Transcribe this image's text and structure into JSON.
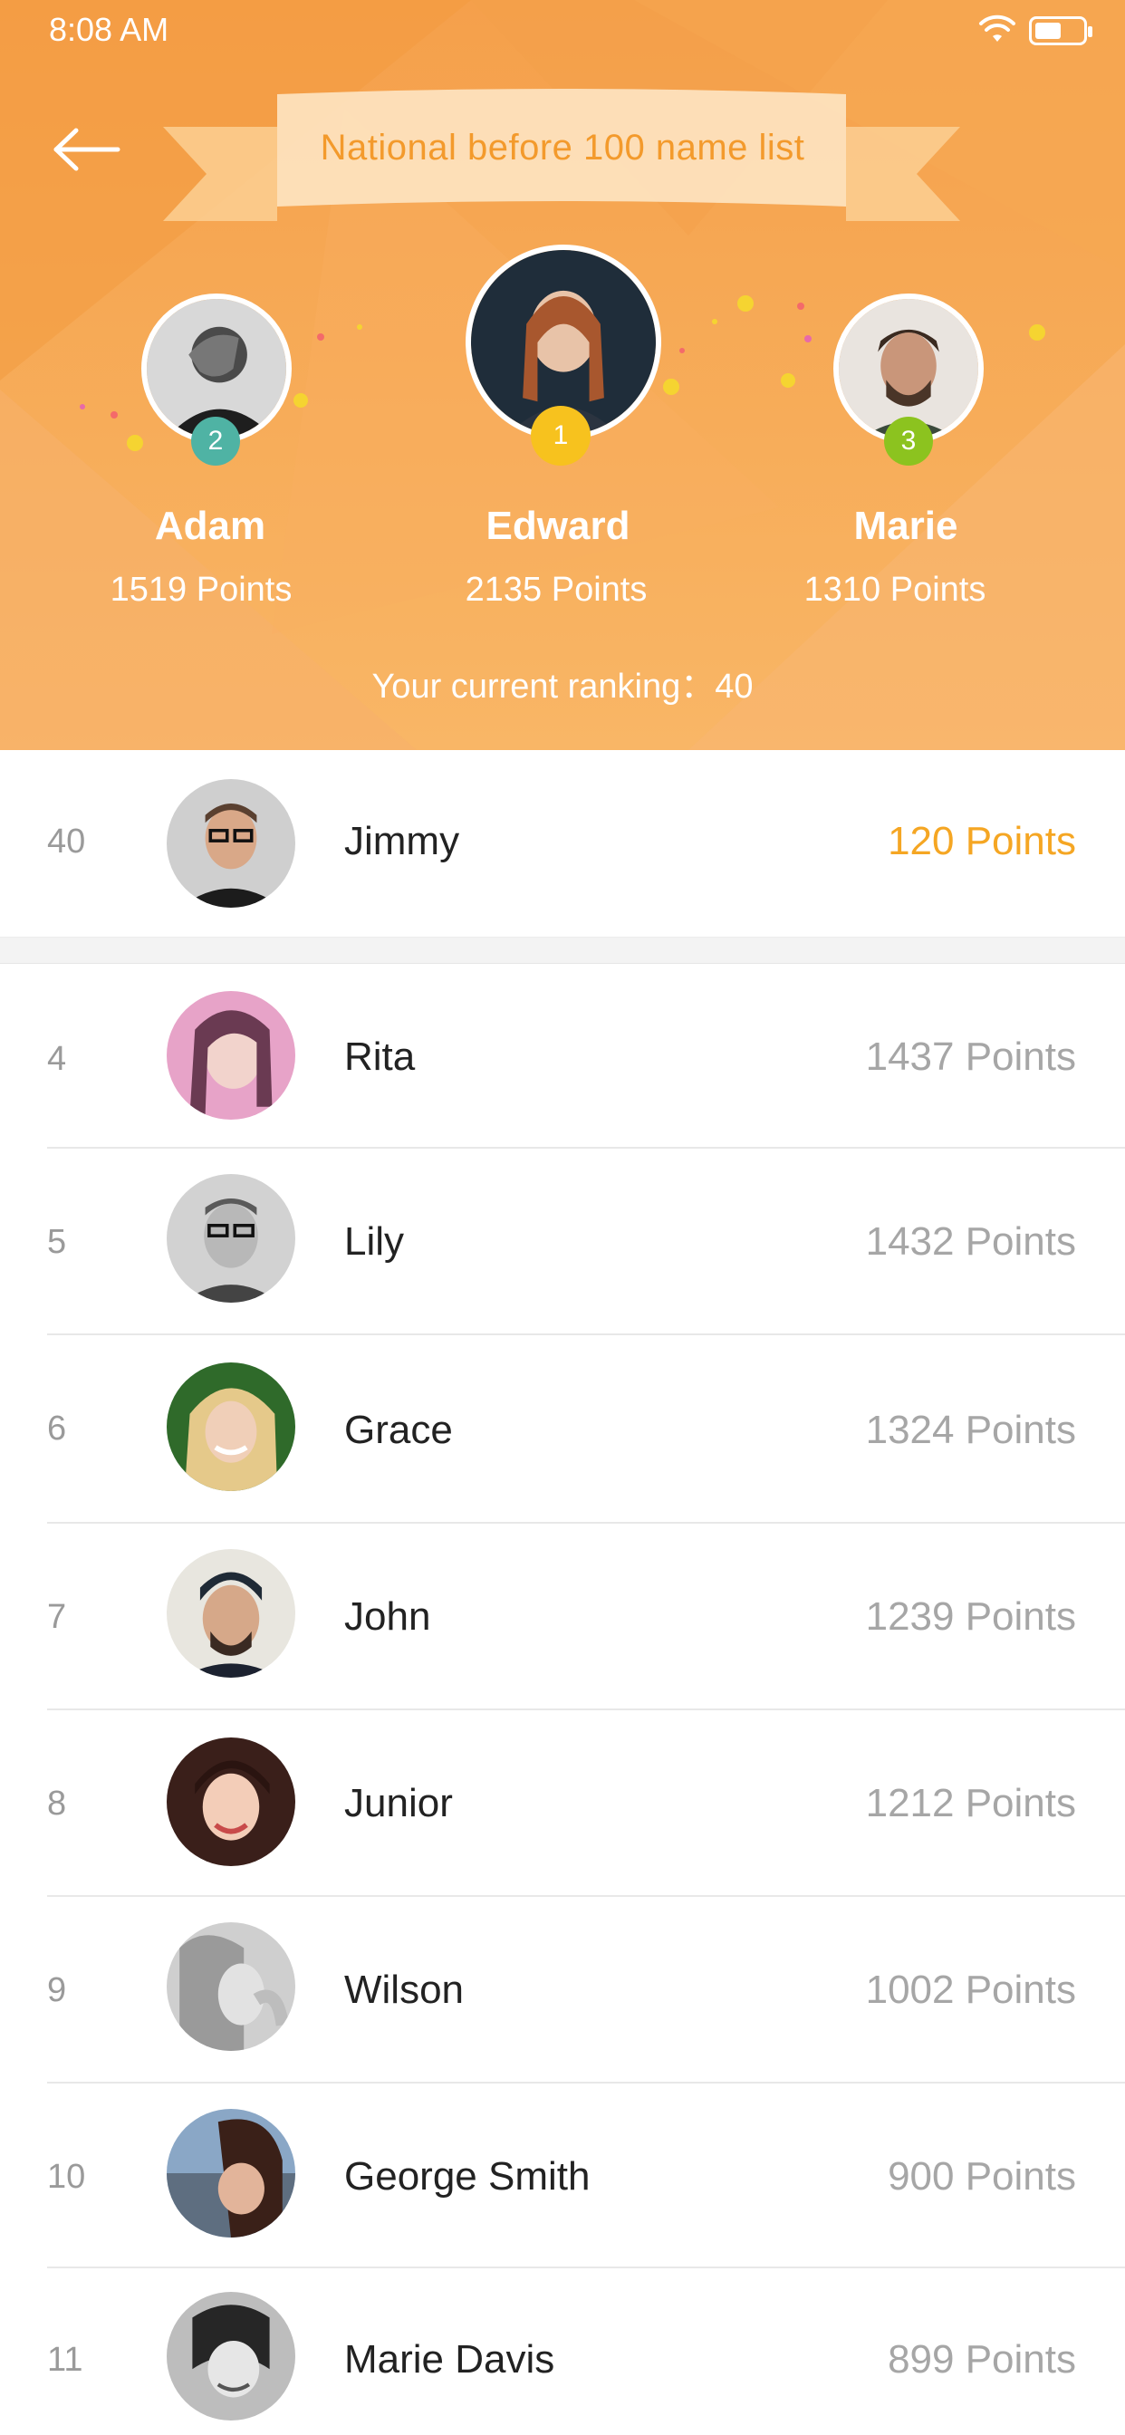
{
  "status_bar": {
    "time": "8:08 AM",
    "battery_level": 0.55
  },
  "header": {
    "title": "National before 100 name list",
    "current_ranking_label": "Your current ranking：",
    "current_ranking_value": "40"
  },
  "podium": [
    {
      "rank": "2",
      "name": "Adam",
      "points": "1519 Points",
      "badge_color": "#4fb3a4"
    },
    {
      "rank": "1",
      "name": "Edward",
      "points": "2135 Points",
      "badge_color": "#f7c21e"
    },
    {
      "rank": "3",
      "name": "Marie",
      "points": "1310 Points",
      "badge_color": "#8cc31f"
    }
  ],
  "my_entry": {
    "rank": "40",
    "name": "Jimmy",
    "points": "120 Points",
    "points_color": "#f5a623"
  },
  "list": [
    {
      "rank": "4",
      "name": "Rita",
      "points": "1437 Points"
    },
    {
      "rank": "5",
      "name": "Lily",
      "points": "1432 Points"
    },
    {
      "rank": "6",
      "name": "Grace",
      "points": "1324 Points"
    },
    {
      "rank": "7",
      "name": "John",
      "points": "1239 Points"
    },
    {
      "rank": "8",
      "name": "Junior",
      "points": "1212 Points"
    },
    {
      "rank": "9",
      "name": "Wilson",
      "points": "1002 Points"
    },
    {
      "rank": "10",
      "name": "George Smith",
      "points": "900 Points"
    },
    {
      "rank": "11",
      "name": "Marie Davis",
      "points": "899 Points"
    }
  ],
  "icons": {
    "back": "arrow-left-icon",
    "wifi": "wifi-icon",
    "battery": "battery-icon"
  },
  "colors": {
    "header_orange": "#f5a04b",
    "title_text": "#f39a2c",
    "accent_points": "#f5a623"
  }
}
